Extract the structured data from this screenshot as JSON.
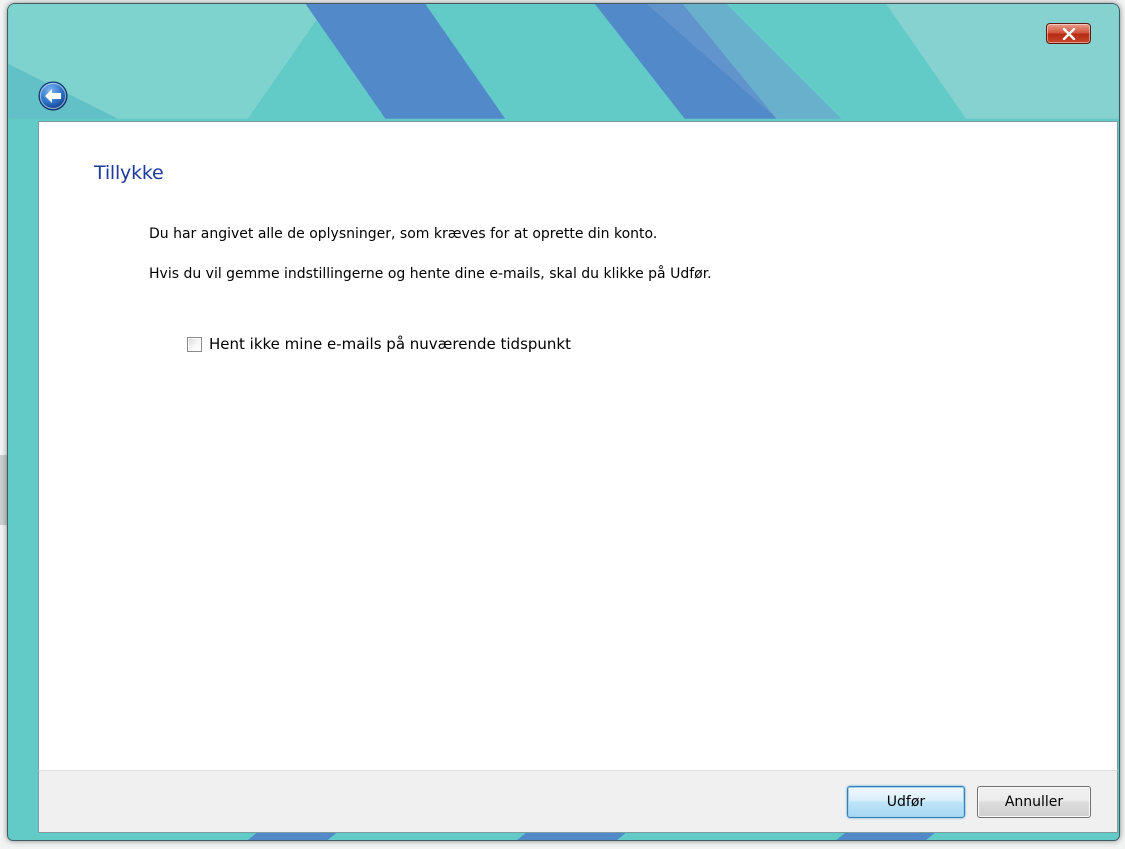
{
  "window": {
    "close_label": "x"
  },
  "wizard": {
    "title": "Tillykke",
    "line1": "Du har angivet alle de oplysninger, som kræves for at oprette din konto.",
    "line2": "Hvis du vil gemme indstillingerne og hente dine e-mails, skal du klikke på Udfør.",
    "checkbox_label": "Hent ikke mine e-mails på nuværende tidspunkt",
    "checkbox_checked": false
  },
  "footer": {
    "finish_label": "Udfør",
    "cancel_label": "Annuller"
  },
  "colors": {
    "frame": "#5ec8c6",
    "frame_band": "#5289c9",
    "title_text": "#1f3a9a",
    "close_button": "#c9452a"
  },
  "icons": {
    "back": "back-arrow-icon",
    "close": "close-icon"
  }
}
